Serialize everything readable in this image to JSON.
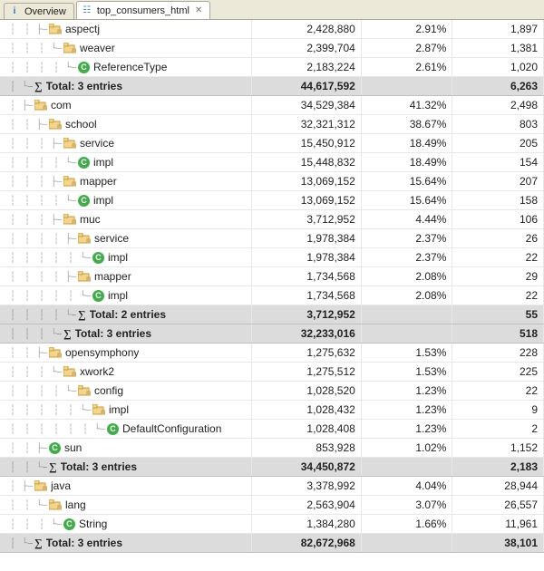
{
  "tabs": {
    "overview": "Overview",
    "active": "top_consumers_html"
  },
  "iconLetters": {
    "info": "i",
    "report": "☷",
    "class": "C",
    "sigma": "∑",
    "close": "✕"
  },
  "totalPrefix": "Total: ",
  "totalSuffix": " entries",
  "treeDecor": {
    "mid": "├–",
    "end": "└–"
  },
  "rows": [
    {
      "indent": 2,
      "last": [
        0,
        0,
        0
      ],
      "kind": "pkg",
      "label": "aspectj",
      "c2": "2,428,880",
      "c3": "2.91%",
      "c4": "1,897"
    },
    {
      "indent": 3,
      "last": [
        0,
        0,
        0,
        1
      ],
      "kind": "pkg",
      "label": "weaver",
      "c2": "2,399,704",
      "c3": "2.87%",
      "c4": "1,381"
    },
    {
      "indent": 4,
      "last": [
        0,
        0,
        0,
        0,
        1
      ],
      "kind": "class",
      "label": "ReferenceType",
      "c2": "2,183,224",
      "c3": "2.61%",
      "c4": "1,020"
    },
    {
      "indent": 1,
      "last": [
        0,
        1
      ],
      "kind": "total",
      "count": 3,
      "c2": "44,617,592",
      "c3": "",
      "c4": "6,263"
    },
    {
      "indent": 1,
      "last": [
        0,
        0
      ],
      "kind": "pkg",
      "label": "com",
      "c2": "34,529,384",
      "c3": "41.32%",
      "c4": "2,498"
    },
    {
      "indent": 2,
      "last": [
        0,
        0,
        0
      ],
      "kind": "pkg",
      "label": "school",
      "c2": "32,321,312",
      "c3": "38.67%",
      "c4": "803"
    },
    {
      "indent": 3,
      "last": [
        0,
        0,
        0,
        0
      ],
      "kind": "pkg",
      "label": "service",
      "c2": "15,450,912",
      "c3": "18.49%",
      "c4": "205"
    },
    {
      "indent": 4,
      "last": [
        0,
        0,
        0,
        0,
        1
      ],
      "kind": "class",
      "label": "impl",
      "c2": "15,448,832",
      "c3": "18.49%",
      "c4": "154"
    },
    {
      "indent": 3,
      "last": [
        0,
        0,
        0,
        0
      ],
      "kind": "pkg",
      "label": "mapper",
      "c2": "13,069,152",
      "c3": "15.64%",
      "c4": "207"
    },
    {
      "indent": 4,
      "last": [
        0,
        0,
        0,
        0,
        1
      ],
      "kind": "class",
      "label": "impl",
      "c2": "13,069,152",
      "c3": "15.64%",
      "c4": "158"
    },
    {
      "indent": 3,
      "last": [
        0,
        0,
        0,
        0
      ],
      "kind": "pkg",
      "label": "muc",
      "c2": "3,712,952",
      "c3": "4.44%",
      "c4": "106"
    },
    {
      "indent": 4,
      "last": [
        0,
        0,
        0,
        0,
        0
      ],
      "kind": "pkg",
      "label": "service",
      "c2": "1,978,384",
      "c3": "2.37%",
      "c4": "26"
    },
    {
      "indent": 5,
      "last": [
        0,
        0,
        0,
        0,
        0,
        1
      ],
      "kind": "class",
      "label": "impl",
      "c2": "1,978,384",
      "c3": "2.37%",
      "c4": "22"
    },
    {
      "indent": 4,
      "last": [
        0,
        0,
        0,
        0,
        0
      ],
      "kind": "pkg",
      "label": "mapper",
      "c2": "1,734,568",
      "c3": "2.08%",
      "c4": "29"
    },
    {
      "indent": 5,
      "last": [
        0,
        0,
        0,
        0,
        0,
        1
      ],
      "kind": "class",
      "label": "impl",
      "c2": "1,734,568",
      "c3": "2.08%",
      "c4": "22"
    },
    {
      "indent": 4,
      "last": [
        0,
        0,
        0,
        0,
        1
      ],
      "kind": "total",
      "count": 2,
      "c2": "3,712,952",
      "c3": "",
      "c4": "55"
    },
    {
      "indent": 3,
      "last": [
        0,
        0,
        0,
        1
      ],
      "kind": "total",
      "count": 3,
      "c2": "32,233,016",
      "c3": "",
      "c4": "518"
    },
    {
      "indent": 2,
      "last": [
        0,
        0,
        0
      ],
      "kind": "pkg",
      "label": "opensymphony",
      "c2": "1,275,632",
      "c3": "1.53%",
      "c4": "228"
    },
    {
      "indent": 3,
      "last": [
        0,
        0,
        0,
        1
      ],
      "kind": "pkg",
      "label": "xwork2",
      "c2": "1,275,512",
      "c3": "1.53%",
      "c4": "225"
    },
    {
      "indent": 4,
      "last": [
        0,
        0,
        0,
        0,
        1
      ],
      "kind": "pkg",
      "label": "config",
      "c2": "1,028,520",
      "c3": "1.23%",
      "c4": "22"
    },
    {
      "indent": 5,
      "last": [
        0,
        0,
        0,
        0,
        0,
        1
      ],
      "kind": "pkg",
      "label": "impl",
      "c2": "1,028,432",
      "c3": "1.23%",
      "c4": "9"
    },
    {
      "indent": 6,
      "last": [
        0,
        0,
        0,
        0,
        0,
        0,
        1
      ],
      "kind": "class",
      "label": "DefaultConfiguration",
      "c2": "1,028,408",
      "c3": "1.23%",
      "c4": "2"
    },
    {
      "indent": 2,
      "last": [
        0,
        0,
        0
      ],
      "kind": "class",
      "label": "sun",
      "c2": "853,928",
      "c3": "1.02%",
      "c4": "1,152"
    },
    {
      "indent": 2,
      "last": [
        0,
        0,
        1
      ],
      "kind": "total",
      "count": 3,
      "c2": "34,450,872",
      "c3": "",
      "c4": "2,183"
    },
    {
      "indent": 1,
      "last": [
        0,
        0
      ],
      "kind": "pkg",
      "label": "java",
      "c2": "3,378,992",
      "c3": "4.04%",
      "c4": "28,944"
    },
    {
      "indent": 2,
      "last": [
        0,
        0,
        1
      ],
      "kind": "pkg",
      "label": "lang",
      "c2": "2,563,904",
      "c3": "3.07%",
      "c4": "26,557"
    },
    {
      "indent": 3,
      "last": [
        0,
        0,
        0,
        1
      ],
      "kind": "class",
      "label": "String",
      "c2": "1,384,280",
      "c3": "1.66%",
      "c4": "11,961"
    },
    {
      "indent": 1,
      "last": [
        0,
        1
      ],
      "kind": "total",
      "count": 3,
      "c2": "82,672,968",
      "c3": "",
      "c4": "38,101"
    }
  ]
}
